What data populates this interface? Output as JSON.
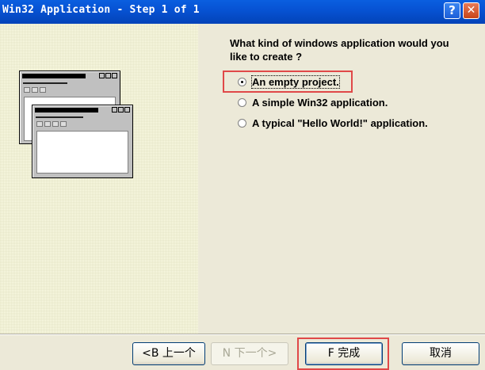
{
  "window": {
    "title": "Win32 Application - Step 1 of 1",
    "help_icon": "help-icon",
    "close_icon": "close-icon",
    "help_glyph": "?",
    "close_glyph": "✕"
  },
  "question": "What kind of windows application would you like to create ?",
  "options": [
    {
      "label": "An empty project.",
      "selected": true
    },
    {
      "label": "A simple Win32 application.",
      "selected": false
    },
    {
      "label": "A typical \"Hello World!\"  application.",
      "selected": false
    }
  ],
  "buttons": {
    "back": "<B 上一个",
    "next": "N 下一个>",
    "finish": "F 完成",
    "cancel": "取消"
  },
  "colors": {
    "titlebar": "#0753d4",
    "dialog_bg": "#ece9d8",
    "illustration_bg": "#fbfbe4",
    "highlight_box": "#e04848"
  }
}
